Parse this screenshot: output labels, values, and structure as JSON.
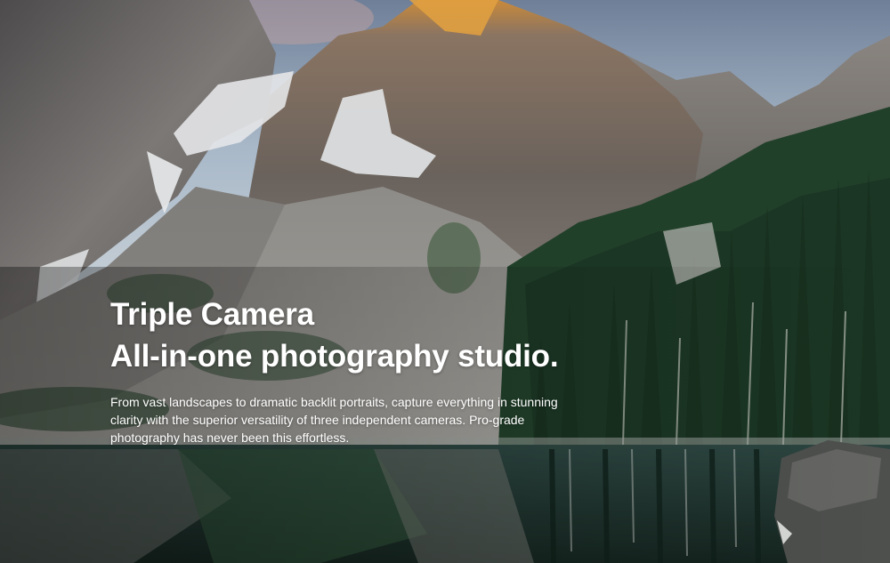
{
  "hero": {
    "title_line1": "Triple Camera",
    "title_line2": "All-in-one photography studio.",
    "description": "From vast landscapes to dramatic backlit portraits, capture everything in stunning clarity with the superior versatility of three independent cameras. Pro-grade photography has never been this effortless."
  },
  "colors": {
    "sky": "#9fb3c7",
    "rock": "#6e6a68",
    "forest": "#1f3a26",
    "lake": "#1e3a34",
    "text": "#ffffff"
  }
}
